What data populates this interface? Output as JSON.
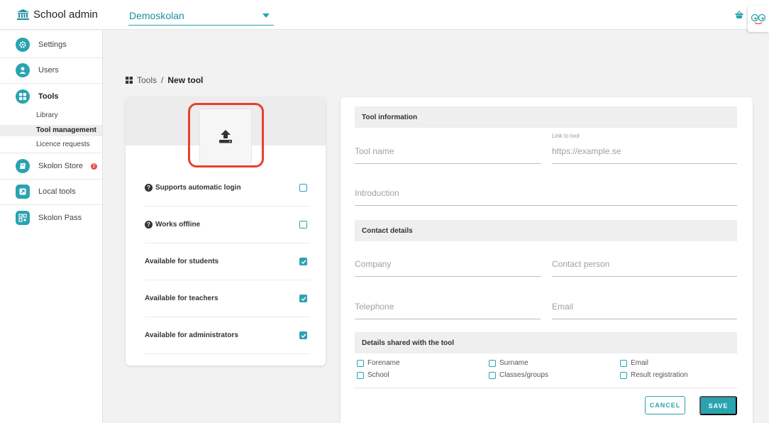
{
  "header": {
    "brand": "School admin",
    "school_value": "Demoskolan",
    "accent_color": "#2aa3b0"
  },
  "sidebar": {
    "items": [
      {
        "label": "Settings",
        "icon": "gear-icon"
      },
      {
        "label": "Users",
        "icon": "user-icon"
      },
      {
        "label": "Tools",
        "icon": "grid-icon"
      },
      {
        "label": "Skolon Store",
        "icon": "book-icon",
        "badge": "2"
      },
      {
        "label": "Local tools",
        "icon": "arrow-box-icon"
      },
      {
        "label": "Skolon Pass",
        "icon": "qr-icon"
      }
    ],
    "subitems": [
      {
        "label": "Library"
      },
      {
        "label": "Tool management"
      },
      {
        "label": "Licence requests"
      }
    ]
  },
  "breadcrumb": {
    "parent": "Tools",
    "separator": "/",
    "current": "New tool"
  },
  "options": [
    {
      "label": "Supports automatic login",
      "help": true,
      "checked": false
    },
    {
      "label": "Works offline",
      "help": true,
      "checked": false
    },
    {
      "label": "Available for students",
      "help": false,
      "checked": true
    },
    {
      "label": "Available for teachers",
      "help": false,
      "checked": true
    },
    {
      "label": "Available for administrators",
      "help": false,
      "checked": true
    }
  ],
  "form": {
    "tool_info_title": "Tool information",
    "tool_name_placeholder": "Tool name",
    "link_label": "Link to tool",
    "link_placeholder": "https://example.se",
    "intro_placeholder": "Introduction",
    "contact_title": "Contact details",
    "company_placeholder": "Company",
    "contact_person_placeholder": "Contact person",
    "telephone_placeholder": "Telephone",
    "email_placeholder": "Email",
    "shared_title": "Details shared with the tool",
    "shared": [
      {
        "label": "Forename"
      },
      {
        "label": "Surname"
      },
      {
        "label": "Email"
      },
      {
        "label": "School"
      },
      {
        "label": "Classes/groups"
      },
      {
        "label": "Result registration"
      }
    ],
    "cancel": "CANCEL",
    "save": "SAVE"
  }
}
